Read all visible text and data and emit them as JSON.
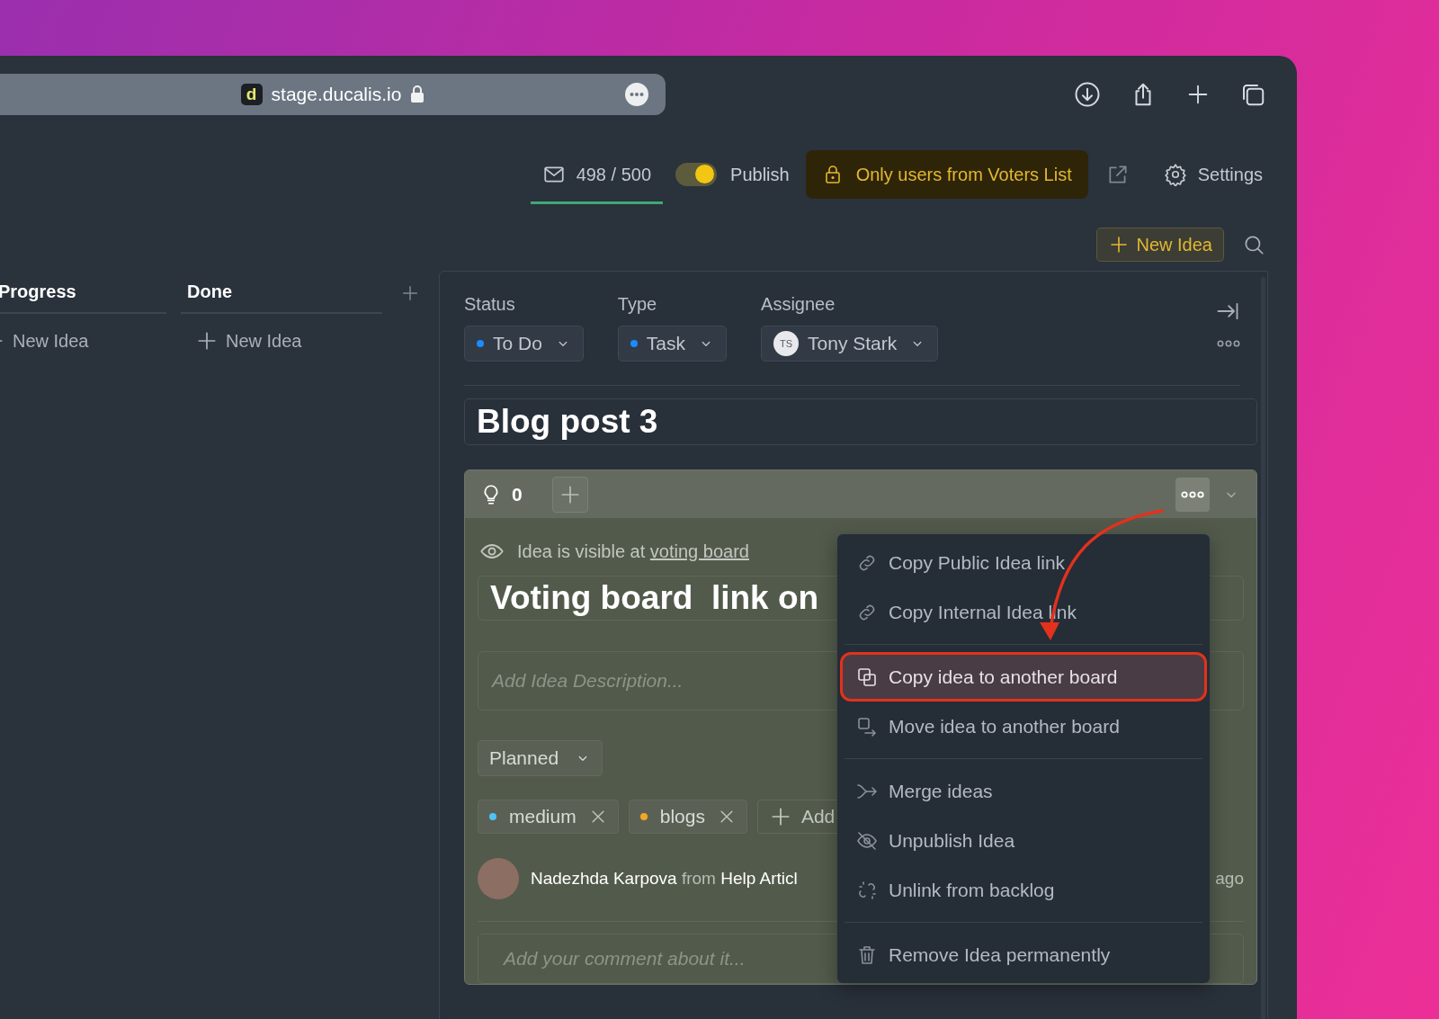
{
  "browser": {
    "favicon_letter": "d",
    "url": "stage.ducalis.io"
  },
  "header": {
    "emails": "498 / 500",
    "publish": {
      "label": "Publish",
      "on": true
    },
    "access_banner": "Only users from Voters List",
    "settings": "Settings",
    "new_idea": "New Idea"
  },
  "columns": [
    {
      "title": "Progress",
      "add_label": "New Idea"
    },
    {
      "title": "Done",
      "add_label": "New Idea"
    }
  ],
  "detail": {
    "fields": [
      {
        "kind": "dot",
        "label": "Status",
        "value": "To Do"
      },
      {
        "kind": "dot",
        "label": "Type",
        "value": "Task"
      },
      {
        "kind": "avatar",
        "label": "Assignee",
        "value": "Tony Stark",
        "initials": "TS"
      }
    ],
    "title": "Blog post 3",
    "card": {
      "votes": "0",
      "visibility_text": "Idea is visible at",
      "visibility_link": "voting board",
      "idea_title": "Voting board  link on",
      "description_placeholder": "Add Idea Description...",
      "stage": "Planned",
      "tags": [
        {
          "label": "medium",
          "color": "#4fc3f7"
        },
        {
          "label": "blogs",
          "color": "#f5a623"
        }
      ],
      "add_tag": "Add",
      "author": "Nadezhda Karpova",
      "from": "from",
      "source": "Help Articl",
      "time": "ago",
      "comment_placeholder": "Add your comment about it..."
    }
  },
  "menu": {
    "groups": [
      [
        {
          "kind": "link",
          "label": "Copy Public Idea link",
          "selected": false
        },
        {
          "kind": "link",
          "label": "Copy Internal Idea link",
          "selected": false
        }
      ],
      [
        {
          "kind": "copy",
          "label": "Copy idea to another board",
          "selected": true
        },
        {
          "kind": "move",
          "label": "Move idea to another board",
          "selected": false
        }
      ],
      [
        {
          "kind": "merge",
          "label": "Merge ideas",
          "selected": false
        },
        {
          "kind": "unpublish",
          "label": "Unpublish Idea",
          "selected": false
        },
        {
          "kind": "unlink",
          "label": "Unlink from backlog",
          "selected": false
        }
      ],
      [
        {
          "kind": "remove",
          "label": "Remove Idea permanently",
          "selected": false
        }
      ]
    ]
  }
}
